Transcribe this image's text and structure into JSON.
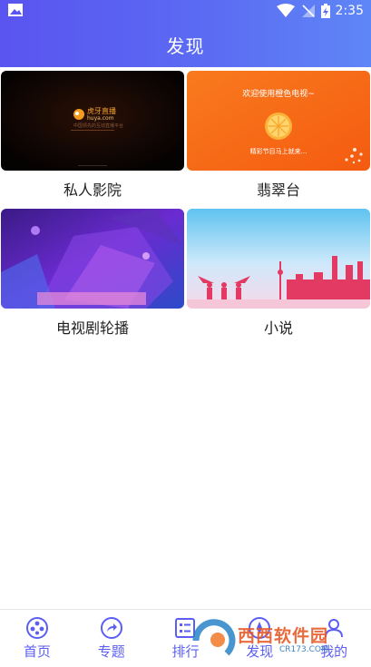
{
  "status_bar": {
    "time": "2:35"
  },
  "header": {
    "title": "发现"
  },
  "cards": [
    {
      "label": "私人影院",
      "thumb_logo": "虎牙直播",
      "thumb_logo_sub": "huya.com",
      "thumb_caption": "中国领先的互动直播平台"
    },
    {
      "label": "翡翠台",
      "thumb_line1": "欢迎使用橙色电视~",
      "thumb_line2": "精彩节目马上就来..."
    },
    {
      "label": "电视剧轮播"
    },
    {
      "label": "小说"
    }
  ],
  "bottom_nav": [
    {
      "label": "首页",
      "icon": "film-reel-icon"
    },
    {
      "label": "专题",
      "icon": "share-icon"
    },
    {
      "label": "排行",
      "icon": "list-icon"
    },
    {
      "label": "发现",
      "icon": "discover-icon"
    },
    {
      "label": "我的",
      "icon": "profile-icon"
    }
  ],
  "watermark": {
    "text": "西西软件园",
    "sub": "CR173.COM"
  },
  "colors": {
    "accent": "#5a5ef2",
    "header_start": "#5a54f0",
    "header_end": "#5f86f6"
  }
}
